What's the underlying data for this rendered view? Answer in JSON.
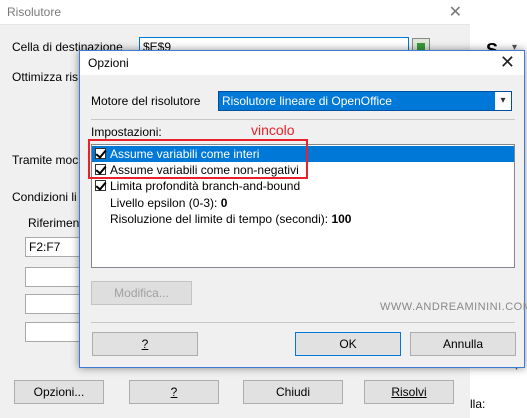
{
  "background": {
    "title": "Risolutore",
    "close": "✕",
    "target_label": "Cella di destinazione",
    "target_value": "$E$9",
    "optimize_label": "Ottimizza ris",
    "via_label": "Tramite moc",
    "conditions_label": "Condizioni li",
    "reference_label": "Riferiment",
    "reference_value": "F2:F7",
    "buttons": {
      "options": "Opzioni...",
      "help": "?",
      "close": "Chiudi",
      "solve": "Risolvi"
    },
    "right_partial": "lla:",
    "right_letter": "S"
  },
  "dialog": {
    "title": "Opzioni",
    "close": "✕",
    "engine_label": "Motore del risolutore",
    "engine_value": "Risolutore lineare di OpenOffice",
    "settings_label": "Impostazioni:",
    "options": [
      {
        "label": "Assume variabili come interi",
        "checked": true,
        "selected": true
      },
      {
        "label": "Assume variabili come non-negativi",
        "checked": true,
        "selected": false
      },
      {
        "label": "Limita profondità branch-and-bound",
        "checked": true,
        "selected": false
      }
    ],
    "params": [
      {
        "label": "Livello epsilon (0-3):",
        "value": "0"
      },
      {
        "label": "Risoluzione del limite di tempo (secondi):",
        "value": "100"
      }
    ],
    "modify_button": "Modifica...",
    "watermark": "WWW.ANDREAMININI.COM",
    "annotation": "vincolo",
    "buttons": {
      "help": "?",
      "ok": "OK",
      "cancel": "Annulla"
    }
  }
}
